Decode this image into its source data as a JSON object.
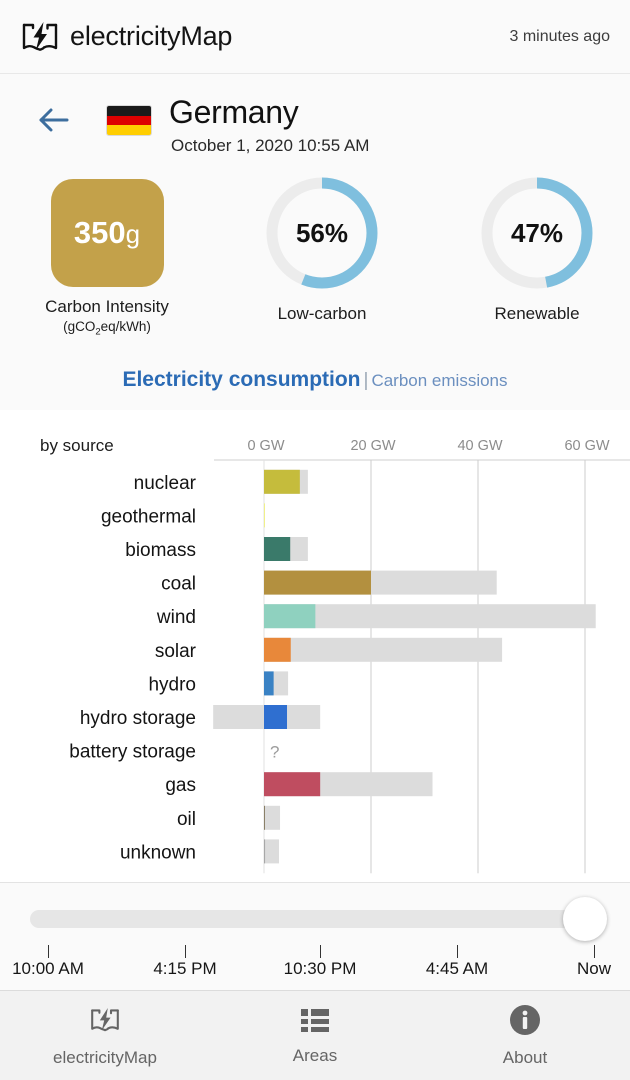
{
  "header": {
    "brand_name": "electricityMap",
    "logo_icon": "electricitymap-book-bolt-icon",
    "updated_text": "3 minutes ago"
  },
  "country": {
    "back_icon": "back-arrow-icon",
    "flag_icon": "germany-flag-icon",
    "name": "Germany",
    "datetime": "October 1, 2020 10:55 AM"
  },
  "metrics": {
    "carbon_intensity": {
      "value": "350",
      "unit": "g",
      "label": "Carbon Intensity",
      "sublabel_prefix": "(gCO",
      "sublabel_sub": "2",
      "sublabel_suffix": "eq/kWh)",
      "color": "#c3a14a"
    },
    "low_carbon": {
      "value": "56%",
      "percent": 56,
      "label": "Low-carbon",
      "color": "#7fbfde"
    },
    "renewable": {
      "value": "47%",
      "percent": 47,
      "label": "Renewable",
      "color": "#7fbfde"
    }
  },
  "tabs": {
    "active_label": "Electricity consumption",
    "divider": "|",
    "inactive_label": "Carbon emissions",
    "active_color": "#2b6bb5"
  },
  "chart_data": {
    "type": "bar",
    "title": "Electricity consumption",
    "subtitle": "by source",
    "xlabel": "",
    "ylabel": "",
    "orientation": "horizontal",
    "xlim": [
      -9.5,
      68
    ],
    "xticks": [
      0,
      20,
      40,
      60
    ],
    "xtick_labels": [
      "0 GW",
      "20 GW",
      "40 GW",
      "60 GW"
    ],
    "grid": true,
    "legend": "none",
    "capacity_color": "#dcdcdc",
    "categories": [
      "nuclear",
      "geothermal",
      "biomass",
      "coal",
      "wind",
      "solar",
      "hydro",
      "hydro storage",
      "battery storage",
      "gas",
      "oil",
      "unknown"
    ],
    "series": [
      {
        "name": "production",
        "values": [
          6.7,
          0.04,
          4.9,
          20.0,
          9.6,
          5.0,
          1.8,
          4.3,
          null,
          10.5,
          0.15,
          0.2
        ]
      },
      {
        "name": "capacity",
        "values": [
          8.2,
          0.04,
          8.2,
          43.5,
          62.0,
          44.5,
          4.5,
          10.5,
          null,
          31.5,
          3.0,
          2.8
        ]
      }
    ],
    "negative_capacity": {
      "hydro storage": -9.5
    },
    "unknown_marker": "?",
    "unknown_marker_category": "battery storage",
    "colors": {
      "nuclear": "#c5bc3c",
      "geothermal": "#f0f08a",
      "biomass": "#3a7a6a",
      "coal": "#b3903f",
      "wind": "#8fd1bf",
      "solar": "#e8883a",
      "hydro": "#3a82c4",
      "hydro storage": "#2f6fd0",
      "battery storage": "#a0a0a0",
      "gas": "#bf4d60",
      "oil": "#8a8068",
      "unknown": "#a8a8a8"
    }
  },
  "timeslider": {
    "handle_icon": "slider-handle",
    "value_label": "Now",
    "tick_labels": [
      "10:00 AM",
      "4:15 PM",
      "10:30 PM",
      "4:45 AM",
      "Now"
    ]
  },
  "bottom_nav": [
    {
      "label": "electricityMap",
      "icon": "electricitymap-book-bolt-icon",
      "active": true
    },
    {
      "label": "Areas",
      "icon": "list-icon",
      "active": false
    },
    {
      "label": "About",
      "icon": "info-circle-icon",
      "active": false
    }
  ]
}
